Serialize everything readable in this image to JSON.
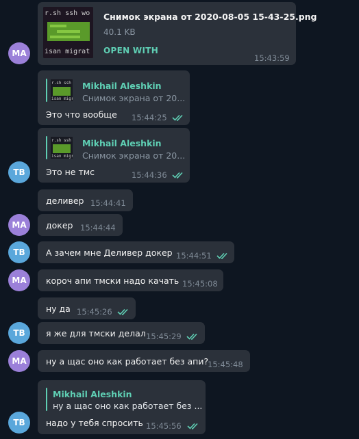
{
  "colors": {
    "background": "#0e1621",
    "bubble": "#2b313a",
    "accent": "#5fcfb4",
    "avatar_ma": "#9b80d9",
    "avatar_tb": "#5aa7db"
  },
  "file_message": {
    "file_name": "Снимок экрана от 2020-08-05 15-43-25.png",
    "file_size": "40.1 KB",
    "open_with": "OPEN WITH",
    "time": "15:43:59",
    "avatar": "MA"
  },
  "messages": [
    {
      "sender": "TB",
      "reply_name": "Mikhail Aleshkin",
      "reply_text": "Снимок экрана от 20...",
      "text": "Это что вообще",
      "time": "15:44:25",
      "read_icon": "double-check-icon"
    },
    {
      "sender": "TB",
      "avatar": "TB",
      "reply_name": "Mikhail Aleshkin",
      "reply_text": "Снимок экрана от 20...",
      "text": "Это не тмс",
      "time": "15:44:36",
      "read_icon": "double-check-icon"
    },
    {
      "sender": "MA",
      "text": "деливер",
      "time": "15:44:41"
    },
    {
      "sender": "MA",
      "avatar": "MA",
      "text": "докер",
      "time": "15:44:44"
    },
    {
      "sender": "TB",
      "avatar": "TB",
      "text": "А зачем мне Деливер докер",
      "time": "15:44:51",
      "read_icon": "double-check-icon"
    },
    {
      "sender": "MA",
      "avatar": "MA",
      "text": "короч апи тмски надо качать",
      "time": "15:45:08"
    },
    {
      "sender": "TB",
      "text": "ну да",
      "time": "15:45:26",
      "read_icon": "double-check-icon"
    },
    {
      "sender": "TB",
      "avatar": "TB",
      "text": "я же для тмски делал",
      "time": "15:45:29",
      "read_icon": "double-check-icon"
    },
    {
      "sender": "MA",
      "avatar": "MA",
      "text": "ну а щас оно как работает без апи?",
      "time": "15:45:48"
    },
    {
      "sender": "TB",
      "avatar": "TB",
      "reply_name": "Mikhail Aleshkin",
      "reply_text": "ну а щас оно как работает без ...",
      "text": "надо у тебя спросить",
      "time": "15:45:56",
      "read_icon": "double-check-icon"
    }
  ]
}
